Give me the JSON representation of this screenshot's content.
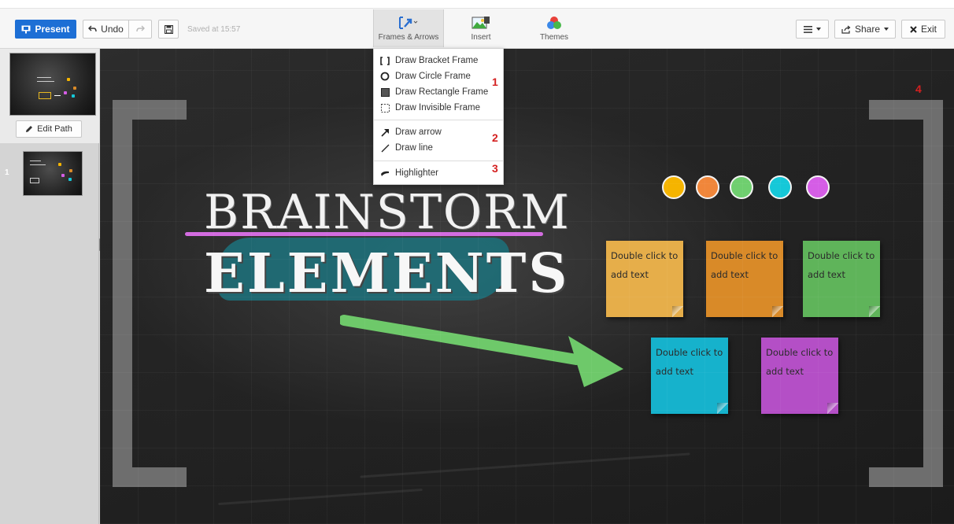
{
  "toolbar": {
    "present_label": "Present",
    "undo_label": "Undo",
    "saved_text": "Saved at 15:57",
    "frames_label": "Frames & Arrows",
    "insert_label": "Insert",
    "themes_label": "Themes",
    "share_label": "Share",
    "exit_label": "Exit"
  },
  "sidebar": {
    "edit_path_label": "Edit Path",
    "slide_number": "1"
  },
  "dropdown": {
    "items": [
      {
        "label": "Draw Bracket Frame",
        "icon": "bracket-frame-icon"
      },
      {
        "label": "Draw Circle Frame",
        "icon": "circle-frame-icon"
      },
      {
        "label": "Draw Rectangle Frame",
        "icon": "rectangle-frame-icon"
      },
      {
        "label": "Draw Invisible Frame",
        "icon": "invisible-frame-icon"
      },
      {
        "label": "Draw arrow",
        "icon": "arrow-icon"
      },
      {
        "label": "Draw line",
        "icon": "line-icon"
      },
      {
        "label": "Highlighter",
        "icon": "highlighter-icon"
      }
    ]
  },
  "annotations": [
    "1",
    "2",
    "3",
    "4"
  ],
  "canvas": {
    "title_line1": "BRAINSTORM",
    "title_line2": "ELEMENTS",
    "color_dots": [
      "#f5b400",
      "#f0863a",
      "#6fcf6f",
      "#15c8d8",
      "#d55de6"
    ],
    "stickies": [
      {
        "text": "Double click to add text",
        "color": "#e6ae4a"
      },
      {
        "text": "Double click to add text",
        "color": "#d98a28"
      },
      {
        "text": "Double click to add text",
        "color": "#5fb45a"
      },
      {
        "text": "Double click to add text",
        "color": "#16b2cc"
      },
      {
        "text": "Double click to add text",
        "color": "#b44fc6"
      }
    ]
  },
  "colors": {
    "accent": "#1d6fd5",
    "arrow": "#6ec96a",
    "underline": "#d36ce0",
    "annotation": "#d42020"
  }
}
